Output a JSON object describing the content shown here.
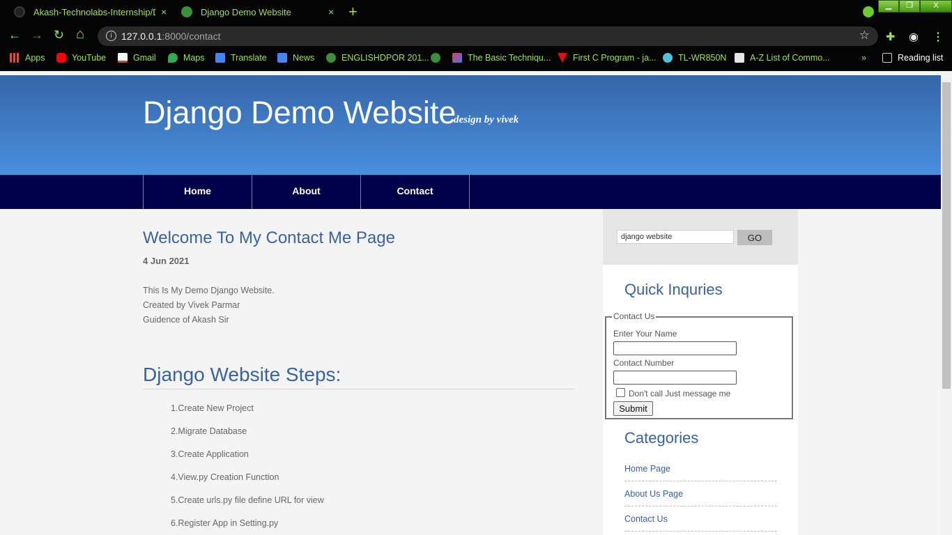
{
  "browser": {
    "tabs": [
      {
        "title": "Akash-Technolabs-Internship/Da",
        "close": "×"
      },
      {
        "title": "Django Demo Website",
        "close": "×"
      }
    ],
    "new_tab": "+",
    "window_controls": {
      "minimize": "▁",
      "maximize": "❐",
      "close": "X"
    },
    "nav": {
      "back": "←",
      "forward": "→",
      "reload": "↻",
      "home": "⌂"
    },
    "url": {
      "host": "127.0.0.1",
      "rest": ":8000/contact"
    },
    "bookmarks": [
      {
        "label": "Apps",
        "icon": "apps-grid-icon",
        "color": "#e04b3a"
      },
      {
        "label": "YouTube",
        "icon": "youtube-icon",
        "color": "#ff0000"
      },
      {
        "label": "Gmail",
        "icon": "gmail-icon",
        "color": "#d44638"
      },
      {
        "label": "Maps",
        "icon": "maps-icon",
        "color": "#34a853"
      },
      {
        "label": "Translate",
        "icon": "translate-icon",
        "color": "#4285f4"
      },
      {
        "label": "News",
        "icon": "news-icon",
        "color": "#4285f4"
      },
      {
        "label": "ENGLISHDPOR 201...",
        "icon": "globe-icon",
        "color": "#3b8f3b"
      },
      {
        "label": "The Basic Techniqu...",
        "icon": "technique-icon",
        "color": "#e23b6b"
      },
      {
        "label": "First C Program - ja...",
        "icon": "javatpoint-icon",
        "color": "#e01010"
      },
      {
        "label": "TL-WR850N",
        "icon": "tplink-icon",
        "color": "#4fc3d9"
      },
      {
        "label": "A-Z List of Commo...",
        "icon": "m-icon",
        "color": "#e8e8e8"
      }
    ],
    "overflow": "»",
    "reading_list": "Reading list",
    "accent": "#9ee05a"
  },
  "site": {
    "title": "Django Demo Website",
    "tagline": "design by vivek",
    "nav": [
      "Home",
      "About",
      "Contact"
    ]
  },
  "main": {
    "heading": "Welcome To My Contact Me Page",
    "date": "4 Jun 2021",
    "paragraph": [
      "This Is My Demo Django Website.",
      "Created by Vivek Parmar",
      "Guidence of Akash Sir"
    ],
    "steps_heading": "Django Website Steps:",
    "steps": [
      "1.Create New Project",
      "2.Migrate Database",
      "3.Create Application",
      "4.View.py Creation Function",
      "5.Create urls.py file define URL for view",
      "6.Register App in Setting.py"
    ]
  },
  "sidebar": {
    "search_value": "django website",
    "search_button": "GO",
    "quick_heading": "Quick Inquries",
    "form": {
      "legend": "Contact Us",
      "name_label": "Enter Your Name",
      "number_label": "Contact Number",
      "checkbox_label": "Don't call Just message me",
      "submit": "Submit"
    },
    "categories_heading": "Categories",
    "categories": [
      "Home Page",
      "About Us Page",
      "Contact Us"
    ]
  }
}
